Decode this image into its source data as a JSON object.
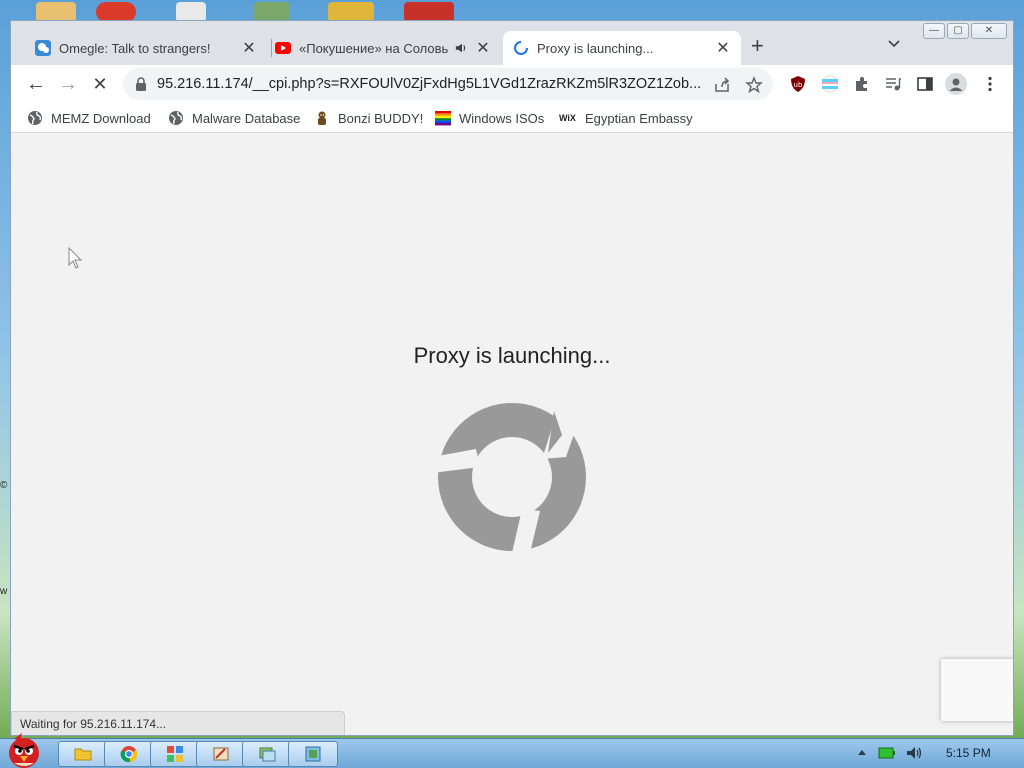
{
  "window": {
    "minimize_glyph": "—",
    "maximize_glyph": "▢",
    "close_glyph": "✕"
  },
  "tabs": [
    {
      "title": "Omegle: Talk to strangers!",
      "favicon": "omegle-icon",
      "active": false,
      "close": "✕"
    },
    {
      "title": "«Покушение» на Соловь",
      "favicon": "youtube-icon",
      "active": false,
      "audio": true,
      "close": "✕"
    },
    {
      "title": "Proxy is launching...",
      "favicon": "loading-spinner-icon",
      "active": true,
      "close": "✕"
    }
  ],
  "tabstrip": {
    "new_tab": "+",
    "tab_search": "⌄"
  },
  "toolbar": {
    "back": "←",
    "forward": "→",
    "stop": "✕",
    "url": "95.216.11.174/__cpi.php?s=RXFOUlV0ZjFxdHg5L1VGd1ZrazRKZm5lR3ZOZ1Zob..."
  },
  "bookmarks": [
    {
      "label": "MEMZ Download",
      "icon": "globe-icon"
    },
    {
      "label": "Malware Database",
      "icon": "globe-icon"
    },
    {
      "label": "Bonzi BUDDY!",
      "icon": "bonzi-icon"
    },
    {
      "label": "Windows ISOs",
      "icon": "rainbow-flag-icon"
    },
    {
      "label": "Egyptian Embassy",
      "icon": "wix-icon"
    }
  ],
  "bookmark_wix_text": "WiX",
  "page": {
    "heading": "Proxy is launching..."
  },
  "status_bar": "Waiting for 95.216.11.174...",
  "taskbar": {
    "clock": "5:15 PM"
  },
  "colors": {
    "spinner": "#999999",
    "tab_active": "#ffffff",
    "tabstrip": "#dee1e6",
    "taskbar": "#8ab8e2"
  }
}
